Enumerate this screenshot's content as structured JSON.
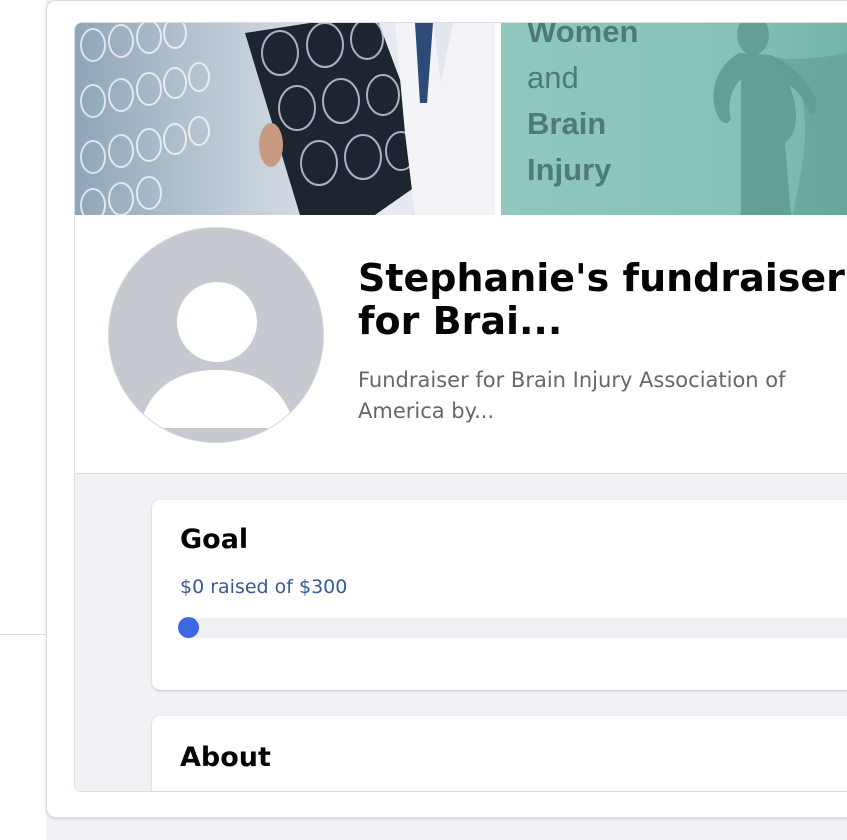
{
  "cover": {
    "banner_lines": [
      "Women",
      "and",
      "Brain",
      "Injury"
    ],
    "banner_color": "#8fc8be",
    "banner_text_color": "#4f7b75"
  },
  "fundraiser": {
    "title": "Stephanie's fundraiser for Brai...",
    "subtitle": "Fundraiser for Brain Injury Association of America by...",
    "avatar": "default-avatar-icon"
  },
  "goal": {
    "heading": "Goal",
    "raised_text": "$0 raised of $300",
    "progress_fraction": 0.0,
    "accent_color": "#3f68e0"
  },
  "about": {
    "heading": "About"
  }
}
